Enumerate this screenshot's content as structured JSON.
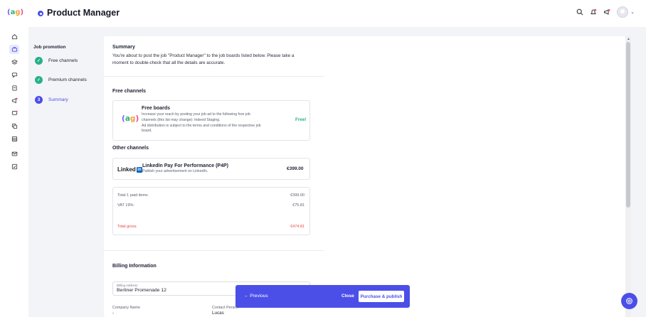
{
  "header": {
    "page_title": "Product Manager",
    "logo_text": "(ag)"
  },
  "nav_icons": [
    "home-icon",
    "briefcase-icon",
    "layers-icon",
    "chat-icon",
    "clipboard-icon",
    "megaphone-icon",
    "message-heart-icon",
    "copy-icon",
    "archive-icon",
    "mail-icon",
    "checklist-icon"
  ],
  "steps": {
    "title": "Job promotion",
    "items": [
      {
        "label": "Free channels",
        "state": "done"
      },
      {
        "label": "Premium channels",
        "state": "done"
      },
      {
        "label": "Summary",
        "state": "current",
        "number": "3"
      }
    ]
  },
  "summary": {
    "heading": "Summary",
    "line1": "You're about to post the job \"Product Manager\" to the job boards listed below. Please take a",
    "line2": "moment to double-check that all the details are accurate."
  },
  "free_channels": {
    "heading": "Free channels",
    "board": {
      "logo": "(ag)",
      "name": "Free boards",
      "desc": [
        "Increase your reach by posting your job ad to the following free job",
        "channels (this list may change): Indeed Staging.",
        "Ad distribution is subject to the terms and conditions of the respective job",
        "board."
      ],
      "price": "Free!"
    }
  },
  "other_channels": {
    "heading": "Other channels",
    "board": {
      "logo_text": "Linked",
      "logo_in": "in",
      "name": "LinkedIn Pay For Performance (P4P)",
      "desc": "Publish your advertisement on LinkedIn.",
      "price": "€399.00"
    }
  },
  "totals": {
    "items_label": "Total 1 paid items",
    "items_value": "€399.00",
    "vat_label": "VAT 19%:",
    "vat_value": "€75.81",
    "gross_label": "Total gross",
    "gross_value": "€474.81"
  },
  "billing": {
    "heading": "Billing Information",
    "address_label": "Billing Address",
    "address_value": "Berliner Promenade 12",
    "company_label": "Company Name",
    "company_value": "-",
    "contact_label": "Contact Person",
    "contact_value": "Lucas"
  },
  "actions": {
    "previous": "← Previous",
    "close": "Close",
    "purchase": "Purchase & publish"
  },
  "colors": {
    "accent": "#4b4fe8",
    "success": "#28b08a",
    "danger": "#e8483f"
  }
}
